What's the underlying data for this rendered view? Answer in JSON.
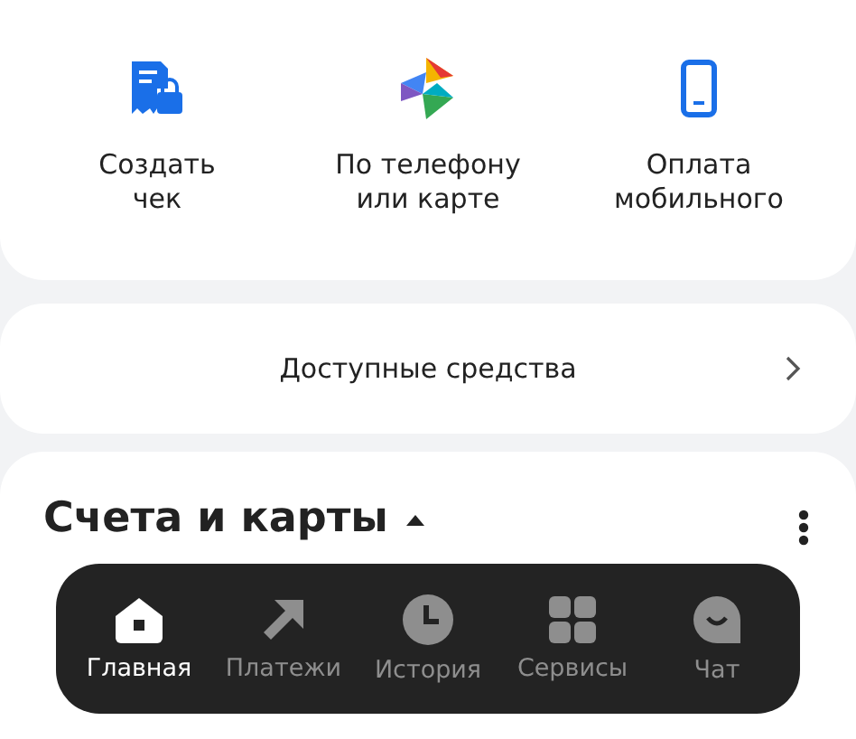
{
  "quick_actions": [
    {
      "label": "Создать\nчек"
    },
    {
      "label": "По телефону\nили карте"
    },
    {
      "label": "Оплата\nмобильного"
    }
  ],
  "available_funds": {
    "label": "Доступные средства"
  },
  "accounts": {
    "title": "Счета и карты",
    "expanded": true
  },
  "bottom_nav": [
    {
      "label": "Главная",
      "selected": true
    },
    {
      "label": "Платежи",
      "selected": false
    },
    {
      "label": "История",
      "selected": false
    },
    {
      "label": "Сервисы",
      "selected": false
    },
    {
      "label": "Чат",
      "selected": false
    }
  ]
}
